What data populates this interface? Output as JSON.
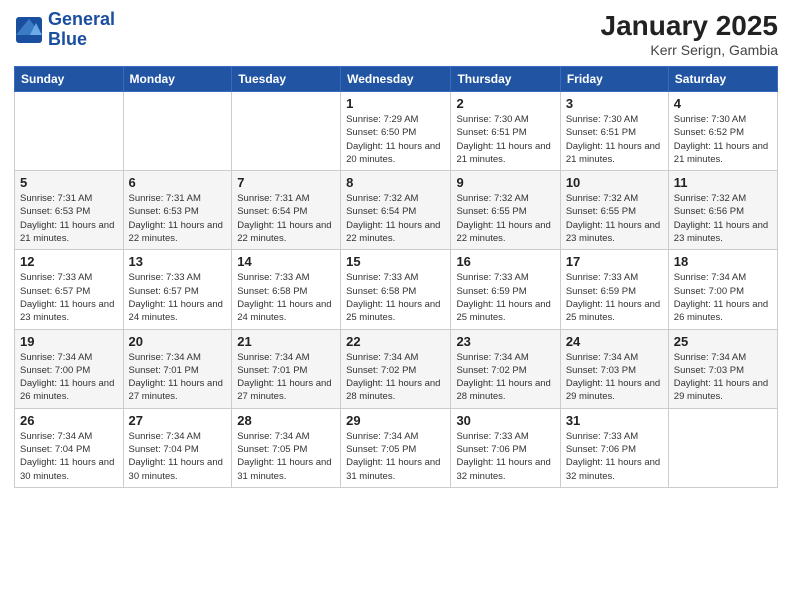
{
  "header": {
    "logo_line1": "General",
    "logo_line2": "Blue",
    "month_year": "January 2025",
    "location": "Kerr Serign, Gambia"
  },
  "weekdays": [
    "Sunday",
    "Monday",
    "Tuesday",
    "Wednesday",
    "Thursday",
    "Friday",
    "Saturday"
  ],
  "weeks": [
    [
      {
        "day": "",
        "sunrise": "",
        "sunset": "",
        "daylight": ""
      },
      {
        "day": "",
        "sunrise": "",
        "sunset": "",
        "daylight": ""
      },
      {
        "day": "",
        "sunrise": "",
        "sunset": "",
        "daylight": ""
      },
      {
        "day": "1",
        "sunrise": "Sunrise: 7:29 AM",
        "sunset": "Sunset: 6:50 PM",
        "daylight": "Daylight: 11 hours and 20 minutes."
      },
      {
        "day": "2",
        "sunrise": "Sunrise: 7:30 AM",
        "sunset": "Sunset: 6:51 PM",
        "daylight": "Daylight: 11 hours and 21 minutes."
      },
      {
        "day": "3",
        "sunrise": "Sunrise: 7:30 AM",
        "sunset": "Sunset: 6:51 PM",
        "daylight": "Daylight: 11 hours and 21 minutes."
      },
      {
        "day": "4",
        "sunrise": "Sunrise: 7:30 AM",
        "sunset": "Sunset: 6:52 PM",
        "daylight": "Daylight: 11 hours and 21 minutes."
      }
    ],
    [
      {
        "day": "5",
        "sunrise": "Sunrise: 7:31 AM",
        "sunset": "Sunset: 6:53 PM",
        "daylight": "Daylight: 11 hours and 21 minutes."
      },
      {
        "day": "6",
        "sunrise": "Sunrise: 7:31 AM",
        "sunset": "Sunset: 6:53 PM",
        "daylight": "Daylight: 11 hours and 22 minutes."
      },
      {
        "day": "7",
        "sunrise": "Sunrise: 7:31 AM",
        "sunset": "Sunset: 6:54 PM",
        "daylight": "Daylight: 11 hours and 22 minutes."
      },
      {
        "day": "8",
        "sunrise": "Sunrise: 7:32 AM",
        "sunset": "Sunset: 6:54 PM",
        "daylight": "Daylight: 11 hours and 22 minutes."
      },
      {
        "day": "9",
        "sunrise": "Sunrise: 7:32 AM",
        "sunset": "Sunset: 6:55 PM",
        "daylight": "Daylight: 11 hours and 22 minutes."
      },
      {
        "day": "10",
        "sunrise": "Sunrise: 7:32 AM",
        "sunset": "Sunset: 6:55 PM",
        "daylight": "Daylight: 11 hours and 23 minutes."
      },
      {
        "day": "11",
        "sunrise": "Sunrise: 7:32 AM",
        "sunset": "Sunset: 6:56 PM",
        "daylight": "Daylight: 11 hours and 23 minutes."
      }
    ],
    [
      {
        "day": "12",
        "sunrise": "Sunrise: 7:33 AM",
        "sunset": "Sunset: 6:57 PM",
        "daylight": "Daylight: 11 hours and 23 minutes."
      },
      {
        "day": "13",
        "sunrise": "Sunrise: 7:33 AM",
        "sunset": "Sunset: 6:57 PM",
        "daylight": "Daylight: 11 hours and 24 minutes."
      },
      {
        "day": "14",
        "sunrise": "Sunrise: 7:33 AM",
        "sunset": "Sunset: 6:58 PM",
        "daylight": "Daylight: 11 hours and 24 minutes."
      },
      {
        "day": "15",
        "sunrise": "Sunrise: 7:33 AM",
        "sunset": "Sunset: 6:58 PM",
        "daylight": "Daylight: 11 hours and 25 minutes."
      },
      {
        "day": "16",
        "sunrise": "Sunrise: 7:33 AM",
        "sunset": "Sunset: 6:59 PM",
        "daylight": "Daylight: 11 hours and 25 minutes."
      },
      {
        "day": "17",
        "sunrise": "Sunrise: 7:33 AM",
        "sunset": "Sunset: 6:59 PM",
        "daylight": "Daylight: 11 hours and 25 minutes."
      },
      {
        "day": "18",
        "sunrise": "Sunrise: 7:34 AM",
        "sunset": "Sunset: 7:00 PM",
        "daylight": "Daylight: 11 hours and 26 minutes."
      }
    ],
    [
      {
        "day": "19",
        "sunrise": "Sunrise: 7:34 AM",
        "sunset": "Sunset: 7:00 PM",
        "daylight": "Daylight: 11 hours and 26 minutes."
      },
      {
        "day": "20",
        "sunrise": "Sunrise: 7:34 AM",
        "sunset": "Sunset: 7:01 PM",
        "daylight": "Daylight: 11 hours and 27 minutes."
      },
      {
        "day": "21",
        "sunrise": "Sunrise: 7:34 AM",
        "sunset": "Sunset: 7:01 PM",
        "daylight": "Daylight: 11 hours and 27 minutes."
      },
      {
        "day": "22",
        "sunrise": "Sunrise: 7:34 AM",
        "sunset": "Sunset: 7:02 PM",
        "daylight": "Daylight: 11 hours and 28 minutes."
      },
      {
        "day": "23",
        "sunrise": "Sunrise: 7:34 AM",
        "sunset": "Sunset: 7:02 PM",
        "daylight": "Daylight: 11 hours and 28 minutes."
      },
      {
        "day": "24",
        "sunrise": "Sunrise: 7:34 AM",
        "sunset": "Sunset: 7:03 PM",
        "daylight": "Daylight: 11 hours and 29 minutes."
      },
      {
        "day": "25",
        "sunrise": "Sunrise: 7:34 AM",
        "sunset": "Sunset: 7:03 PM",
        "daylight": "Daylight: 11 hours and 29 minutes."
      }
    ],
    [
      {
        "day": "26",
        "sunrise": "Sunrise: 7:34 AM",
        "sunset": "Sunset: 7:04 PM",
        "daylight": "Daylight: 11 hours and 30 minutes."
      },
      {
        "day": "27",
        "sunrise": "Sunrise: 7:34 AM",
        "sunset": "Sunset: 7:04 PM",
        "daylight": "Daylight: 11 hours and 30 minutes."
      },
      {
        "day": "28",
        "sunrise": "Sunrise: 7:34 AM",
        "sunset": "Sunset: 7:05 PM",
        "daylight": "Daylight: 11 hours and 31 minutes."
      },
      {
        "day": "29",
        "sunrise": "Sunrise: 7:34 AM",
        "sunset": "Sunset: 7:05 PM",
        "daylight": "Daylight: 11 hours and 31 minutes."
      },
      {
        "day": "30",
        "sunrise": "Sunrise: 7:33 AM",
        "sunset": "Sunset: 7:06 PM",
        "daylight": "Daylight: 11 hours and 32 minutes."
      },
      {
        "day": "31",
        "sunrise": "Sunrise: 7:33 AM",
        "sunset": "Sunset: 7:06 PM",
        "daylight": "Daylight: 11 hours and 32 minutes."
      },
      {
        "day": "",
        "sunrise": "",
        "sunset": "",
        "daylight": ""
      }
    ]
  ]
}
